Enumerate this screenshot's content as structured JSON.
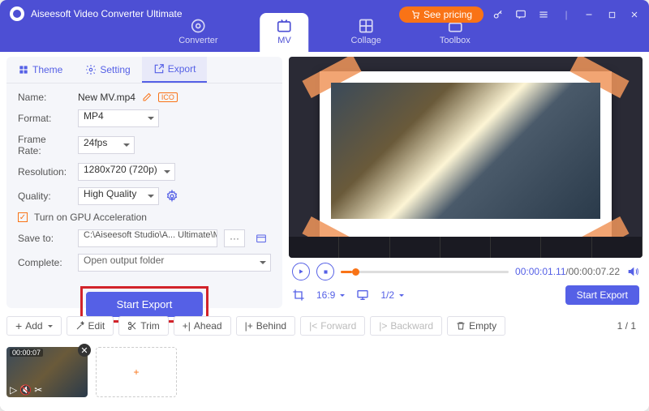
{
  "app": {
    "title": "Aiseesoft Video Converter Ultimate"
  },
  "header": {
    "pricing": "See pricing",
    "tabs": [
      {
        "label": "Converter"
      },
      {
        "label": "MV"
      },
      {
        "label": "Collage"
      },
      {
        "label": "Toolbox"
      }
    ]
  },
  "subtabs": {
    "theme": "Theme",
    "setting": "Setting",
    "export": "Export"
  },
  "form": {
    "name_label": "Name:",
    "name_value": "New MV.mp4",
    "badge": "ICO",
    "format_label": "Format:",
    "format_value": "MP4",
    "framerate_label": "Frame Rate:",
    "framerate_value": "24fps",
    "resolution_label": "Resolution:",
    "resolution_value": "1280x720 (720p)",
    "quality_label": "Quality:",
    "quality_value": "High Quality",
    "gpu_label": "Turn on GPU Acceleration",
    "save_label": "Save to:",
    "save_path": "C:\\Aiseesoft Studio\\A... Ultimate\\MV Exported",
    "dots": "···",
    "complete_label": "Complete:",
    "complete_value": "Open output folder",
    "export_btn": "Start Export"
  },
  "player": {
    "time_current": "00:00:01.11",
    "time_total": "00:00:07.22",
    "aspect": "16:9",
    "page": "1/2",
    "export_btn": "Start Export"
  },
  "toolbar": {
    "add": "Add",
    "edit": "Edit",
    "trim": "Trim",
    "ahead": "Ahead",
    "behind": "Behind",
    "forward": "Forward",
    "backward": "Backward",
    "empty": "Empty",
    "pagination": "1 / 1"
  },
  "thumb": {
    "duration": "00:00:07",
    "plus": "+"
  }
}
